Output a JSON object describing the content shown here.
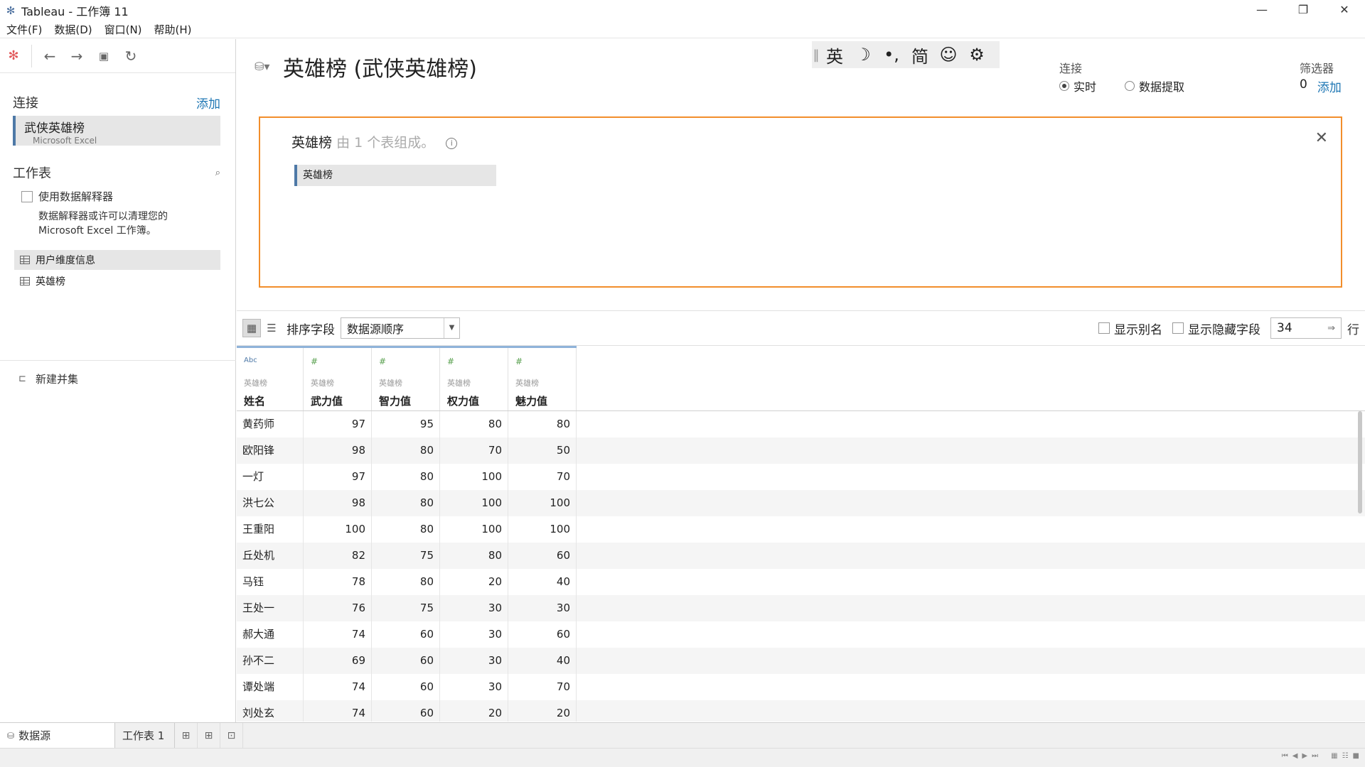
{
  "window": {
    "title": "Tableau - 工作簿 11",
    "controls": {
      "minimize": "—",
      "restore": "❐",
      "close": "✕"
    }
  },
  "menu": [
    "文件(F)",
    "数据(D)",
    "窗口(N)",
    "帮助(H)"
  ],
  "left": {
    "toolbar_icons": [
      "tableau-logo-icon",
      "back-icon",
      "forward-icon",
      "save-icon",
      "refresh-icon"
    ],
    "connections_title": "连接",
    "add_label": "添加",
    "connection": {
      "name": "武侠英雄榜",
      "type": "Microsoft Excel"
    },
    "worksheets_title": "工作表",
    "interpreter_label": "使用数据解释器",
    "interpreter_desc_1": "数据解释器或许可以清理您的",
    "interpreter_desc_2": "Microsoft Excel 工作簿。",
    "sheets": [
      "用户维度信息",
      "英雄榜"
    ],
    "new_union": "新建并集"
  },
  "header": {
    "datasource_title": "英雄榜 (武侠英雄榜)",
    "ime": [
      "英",
      "☽",
      "•,",
      "简",
      "☺",
      "⚙"
    ],
    "connection_label": "连接",
    "live_label": "实时",
    "extract_label": "数据提取",
    "connection_mode": "实时",
    "filters_label": "筛选器",
    "filters_count": "0",
    "filters_add": "添加"
  },
  "join": {
    "table_name": "英雄榜",
    "composition": "由 1 个表组成。",
    "info": "i",
    "close": "✕",
    "chip": "英雄榜"
  },
  "grid_toolbar": {
    "sort_label": "排序字段",
    "sort_value": "数据源顺序",
    "show_alias": "显示别名",
    "show_hidden": "显示隐藏字段",
    "rows_value": "34",
    "rows_label": "行"
  },
  "columns": [
    {
      "type": "Abc",
      "source": "英雄榜",
      "name": "姓名"
    },
    {
      "type": "#",
      "source": "英雄榜",
      "name": "武力值"
    },
    {
      "type": "#",
      "source": "英雄榜",
      "name": "智力值"
    },
    {
      "type": "#",
      "source": "英雄榜",
      "name": "权力值"
    },
    {
      "type": "#",
      "source": "英雄榜",
      "name": "魅力值"
    }
  ],
  "rows": [
    [
      "黄药师",
      "97",
      "95",
      "80",
      "80"
    ],
    [
      "欧阳锋",
      "98",
      "80",
      "70",
      "50"
    ],
    [
      "一灯",
      "97",
      "80",
      "100",
      "70"
    ],
    [
      "洪七公",
      "98",
      "80",
      "100",
      "100"
    ],
    [
      "王重阳",
      "100",
      "80",
      "100",
      "100"
    ],
    [
      "丘处机",
      "82",
      "75",
      "80",
      "60"
    ],
    [
      "马钰",
      "78",
      "80",
      "20",
      "40"
    ],
    [
      "王处一",
      "76",
      "75",
      "30",
      "30"
    ],
    [
      "郝大通",
      "74",
      "60",
      "30",
      "60"
    ],
    [
      "孙不二",
      "69",
      "60",
      "30",
      "40"
    ],
    [
      "谭处端",
      "74",
      "60",
      "30",
      "70"
    ],
    [
      "刘处玄",
      "74",
      "60",
      "20",
      "20"
    ]
  ],
  "tabs": {
    "datasource": "数据源",
    "sheet1": "工作表 1"
  },
  "colors": {
    "accent": "#4e79a7",
    "join_border": "#f28e2b",
    "link": "#1f77b4"
  }
}
